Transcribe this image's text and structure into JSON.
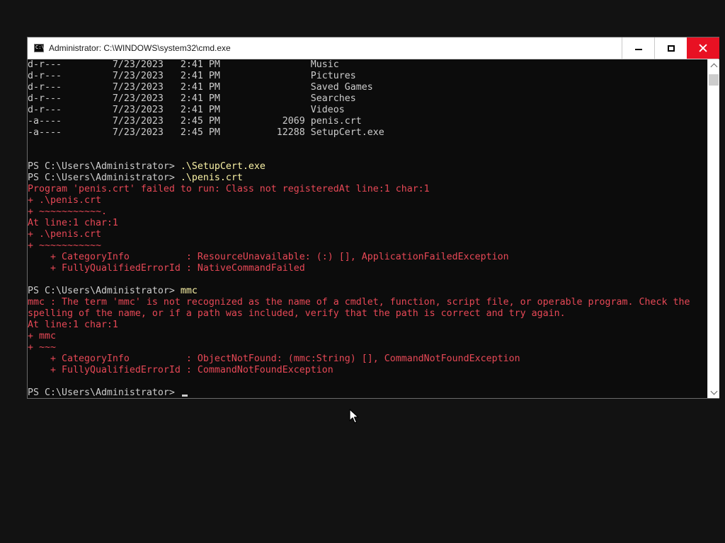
{
  "window": {
    "title": "Administrator: C:\\WINDOWS\\system32\\cmd.exe",
    "icon": "cmd-icon",
    "buttons": {
      "minimize": "minimize-icon",
      "maximize": "maximize-icon",
      "close": "close-icon"
    }
  },
  "colors": {
    "console_background": "#0c0c0c",
    "console_text": "#cccccc",
    "command_text": "#f9f1a5",
    "error_text": "#e74856",
    "close_button": "#e81123",
    "desktop": "#121212"
  },
  "console": {
    "lines": [
      {
        "type": "plain",
        "text": "d-r---         7/23/2023   2:41 PM                Music"
      },
      {
        "type": "plain",
        "text": "d-r---         7/23/2023   2:41 PM                Pictures"
      },
      {
        "type": "plain",
        "text": "d-r---         7/23/2023   2:41 PM                Saved Games"
      },
      {
        "type": "plain",
        "text": "d-r---         7/23/2023   2:41 PM                Searches"
      },
      {
        "type": "plain",
        "text": "d-r---         7/23/2023   2:41 PM                Videos"
      },
      {
        "type": "plain",
        "text": "-a----         7/23/2023   2:45 PM           2069 penis.crt"
      },
      {
        "type": "plain",
        "text": "-a----         7/23/2023   2:45 PM          12288 SetupCert.exe"
      },
      {
        "type": "plain",
        "text": ""
      },
      {
        "type": "plain",
        "text": ""
      },
      {
        "type": "prompt",
        "prompt": "PS C:\\Users\\Administrator> ",
        "command": ".\\SetupCert.exe"
      },
      {
        "type": "prompt",
        "prompt": "PS C:\\Users\\Administrator> ",
        "command": ".\\penis.crt"
      },
      {
        "type": "error",
        "text": "Program 'penis.crt' failed to run: Class not registeredAt line:1 char:1"
      },
      {
        "type": "error",
        "text": "+ .\\penis.crt"
      },
      {
        "type": "error",
        "text": "+ ~~~~~~~~~~~."
      },
      {
        "type": "error",
        "text": "At line:1 char:1"
      },
      {
        "type": "error",
        "text": "+ .\\penis.crt"
      },
      {
        "type": "error",
        "text": "+ ~~~~~~~~~~~"
      },
      {
        "type": "error",
        "text": "    + CategoryInfo          : ResourceUnavailable: (:) [], ApplicationFailedException"
      },
      {
        "type": "error",
        "text": "    + FullyQualifiedErrorId : NativeCommandFailed"
      },
      {
        "type": "plain",
        "text": ""
      },
      {
        "type": "prompt",
        "prompt": "PS C:\\Users\\Administrator> ",
        "command": "mmc"
      },
      {
        "type": "error",
        "text": "mmc : The term 'mmc' is not recognized as the name of a cmdlet, function, script file, or operable program. Check the"
      },
      {
        "type": "error",
        "text": "spelling of the name, or if a path was included, verify that the path is correct and try again."
      },
      {
        "type": "error",
        "text": "At line:1 char:1"
      },
      {
        "type": "error",
        "text": "+ mmc"
      },
      {
        "type": "error",
        "text": "+ ~~~"
      },
      {
        "type": "error",
        "text": "    + CategoryInfo          : ObjectNotFound: (mmc:String) [], CommandNotFoundException"
      },
      {
        "type": "error",
        "text": "    + FullyQualifiedErrorId : CommandNotFoundException"
      },
      {
        "type": "plain",
        "text": ""
      },
      {
        "type": "prompt",
        "prompt": "PS C:\\Users\\Administrator> ",
        "command": "",
        "cursor": true
      }
    ]
  },
  "scrollbar": {
    "up_icon": "chevron-up-icon",
    "down_icon": "chevron-down-icon"
  },
  "pointer": {
    "icon": "mouse-pointer-icon"
  }
}
